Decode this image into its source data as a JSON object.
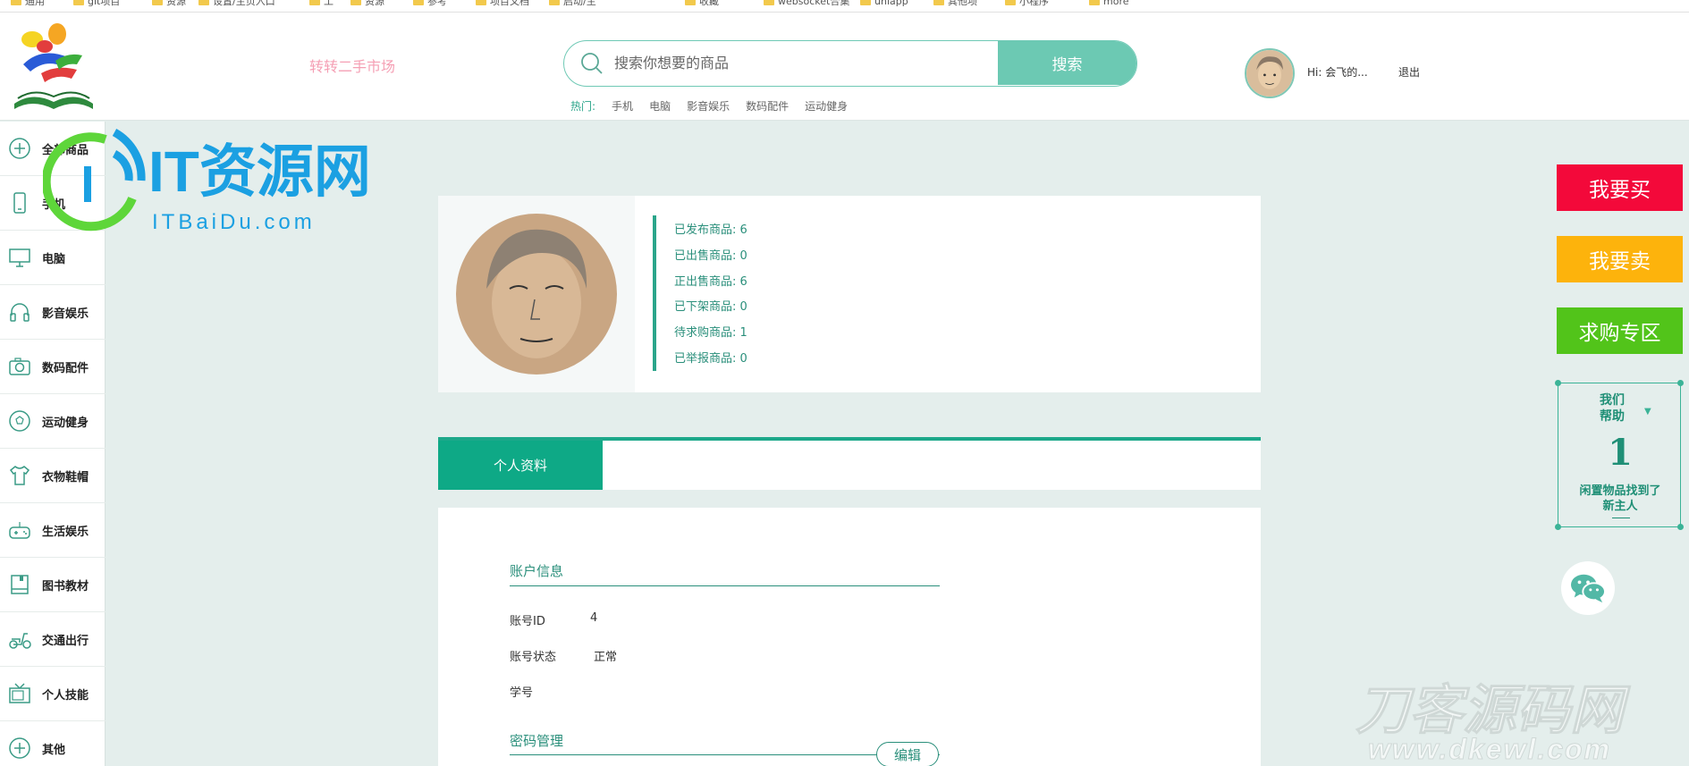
{
  "bookmarks": [
    "通用",
    "git项目",
    "资源",
    "设置/主页入口",
    "工",
    "资源",
    "参考",
    "项目文档",
    "启动/主",
    "收藏",
    "websocket合集",
    "uniapp",
    "其他项",
    "小程序",
    "more"
  ],
  "header": {
    "market_title": "转转二手市场",
    "search_placeholder": "搜索你想要的商品",
    "search_button": "搜索",
    "hot_label": "热门:",
    "hot_items": [
      "手机",
      "电脑",
      "影音娱乐",
      "数码配件",
      "运动健身"
    ],
    "greeting": "Hi: 会飞的...",
    "logout": "退出"
  },
  "sidebar": {
    "items": [
      {
        "label": "全部商品",
        "icon": "plus-circle-icon"
      },
      {
        "label": "手机",
        "icon": "phone-icon"
      },
      {
        "label": "电脑",
        "icon": "monitor-icon"
      },
      {
        "label": "影音娱乐",
        "icon": "headphones-icon"
      },
      {
        "label": "数码配件",
        "icon": "camera-icon"
      },
      {
        "label": "运动健身",
        "icon": "football-icon"
      },
      {
        "label": "衣物鞋帽",
        "icon": "tshirt-icon"
      },
      {
        "label": "生活娱乐",
        "icon": "gamepad-icon"
      },
      {
        "label": "图书教材",
        "icon": "book-icon"
      },
      {
        "label": "交通出行",
        "icon": "scooter-icon"
      },
      {
        "label": "个人技能",
        "icon": "tv-icon"
      },
      {
        "label": "其他",
        "icon": "plus-circle-icon"
      }
    ]
  },
  "watermarks": {
    "it_main": "IT资源网",
    "it_sub": "ITBaiDu.com",
    "dk_main": "刀客源码网",
    "dk_sub": "www.dkewl.com"
  },
  "profile": {
    "stats": [
      "已发布商品: 6",
      "已出售商品: 0",
      "正出售商品: 6",
      "已下架商品: 0",
      "待求购商品: 1",
      "已举报商品: 0"
    ]
  },
  "tabs": {
    "active": "个人资料"
  },
  "account": {
    "section_title": "账户信息",
    "id_label": "账号ID",
    "id_value": "4",
    "status_label": "账号状态",
    "status_value": "正常",
    "student_label": "学号",
    "password_title": "密码管理",
    "edit_button": "编辑"
  },
  "actions": {
    "buy": "我要买",
    "sell": "我要卖",
    "wanted": "求购专区",
    "buy_color": "#f3093a",
    "sell_color": "#fdb30c",
    "wanted_color": "#52c41a"
  },
  "help": {
    "title_line1": "我们",
    "title_line2": "帮助",
    "number": "1",
    "text_line1": "闲置物品找到了",
    "text_line2": "新主人"
  }
}
